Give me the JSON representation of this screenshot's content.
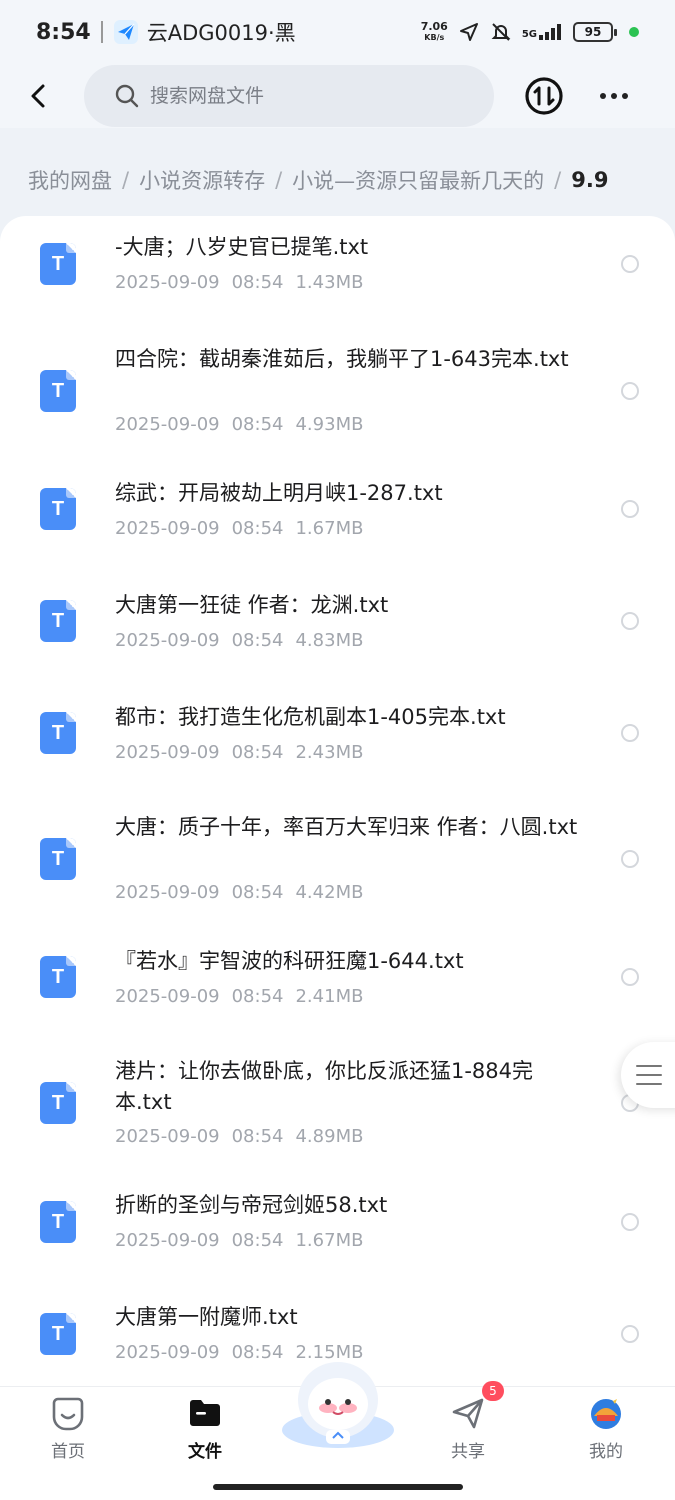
{
  "status_bar": {
    "time": "8:54",
    "carrier": "云ADG0019·黑",
    "net_speed_value": "7.06",
    "net_speed_unit": "KB/s",
    "network": "5G",
    "battery": "95",
    "accent_dot_color": "#2bc252"
  },
  "header": {
    "back_icon": "chevron-left-icon",
    "search_placeholder": "搜索网盘文件",
    "transfer_icon": "transfer-icon",
    "more_icon": "more-dots-icon"
  },
  "breadcrumb": {
    "items": [
      "我的网盘",
      "小说资源转存",
      "小说—资源只留最新几天的"
    ],
    "separator": "/",
    "current": "9.9"
  },
  "files": [
    {
      "icon_letter": "T",
      "name": "-大唐；八岁史官已提笔.txt",
      "date": "2025-09-09",
      "time": "08:54",
      "size": "1.43MB"
    },
    {
      "icon_letter": "T",
      "name": "四合院：截胡秦淮茹后，我躺平了1-643完本.txt",
      "date": "2025-09-09",
      "time": "08:54",
      "size": "4.93MB"
    },
    {
      "icon_letter": "T",
      "name": "综武：开局被劫上明月峡1-287.txt",
      "date": "2025-09-09",
      "time": "08:54",
      "size": "1.67MB"
    },
    {
      "icon_letter": "T",
      "name": "大唐第一狂徒 作者：龙渊.txt",
      "date": "2025-09-09",
      "time": "08:54",
      "size": "4.83MB"
    },
    {
      "icon_letter": "T",
      "name": "都市：我打造生化危机副本1-405完本.txt",
      "date": "2025-09-09",
      "time": "08:54",
      "size": "2.43MB"
    },
    {
      "icon_letter": "T",
      "name": "大唐：质子十年，率百万大军归来 作者：八圆.txt",
      "date": "2025-09-09",
      "time": "08:54",
      "size": "4.42MB"
    },
    {
      "icon_letter": "T",
      "name": "『若水』宇智波的科研狂魔1-644.txt",
      "date": "2025-09-09",
      "time": "08:54",
      "size": "2.41MB"
    },
    {
      "icon_letter": "T",
      "name": "港片：让你去做卧底，你比反派还猛1-884完本.txt",
      "date": "2025-09-09",
      "time": "08:54",
      "size": "4.89MB"
    },
    {
      "icon_letter": "T",
      "name": "折断的圣剑与帝冠剑姬58.txt",
      "date": "2025-09-09",
      "time": "08:54",
      "size": "1.67MB"
    },
    {
      "icon_letter": "T",
      "name": "大唐第一附魔师.txt",
      "date": "2025-09-09",
      "time": "08:54",
      "size": "2.15MB"
    }
  ],
  "file_icon_color": "#4a8ef8",
  "float_menu_icon": "menu-icon",
  "bottom_nav": {
    "items": [
      {
        "label": "首页",
        "icon": "home-icon",
        "active": false
      },
      {
        "label": "文件",
        "icon": "folder-icon",
        "active": true
      },
      {
        "label": "共享",
        "icon": "share-icon",
        "active": false,
        "badge": "5"
      },
      {
        "label": "我的",
        "icon": "avatar-icon",
        "active": false
      }
    ],
    "mascot_icon": "mascot-icon",
    "badge_color": "#ff4d5e"
  }
}
